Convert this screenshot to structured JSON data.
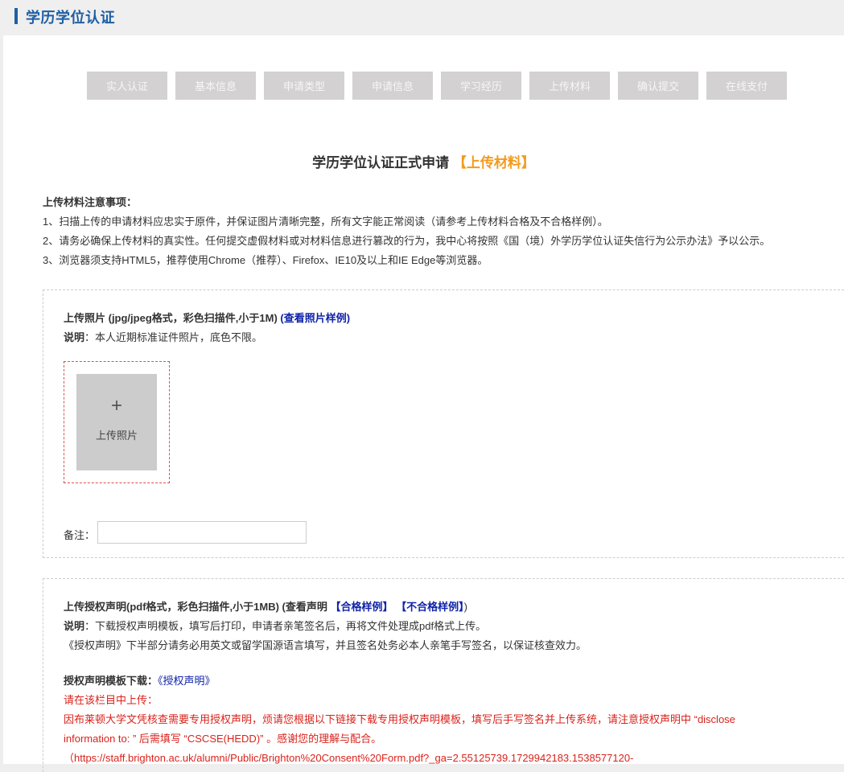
{
  "header": {
    "title": "学历学位认证"
  },
  "steps": [
    "实人认证",
    "基本信息",
    "申请类型",
    "申请信息",
    "学习经历",
    "上传材料",
    "确认提交",
    "在线支付"
  ],
  "page": {
    "heading": "学历学位认证正式申请",
    "heading_accent": "【上传材料】"
  },
  "notes": {
    "title": "上传材料注意事项：",
    "items": [
      "1、扫描上传的申请材料应忠实于原件，并保证图片清晰完整，所有文字能正常阅读（请参考上传材料合格及不合格样例）。",
      "2、请务必确保上传材料的真实性。任何提交虚假材料或对材料信息进行篡改的行为，我中心将按照《国（境）外学历学位认证失信行为公示办法》予以公示。",
      "3、浏览器须支持HTML5，推荐使用Chrome（推荐）、Firefox、IE10及以上和IE Edge等浏览器。"
    ]
  },
  "photo_section": {
    "title": "上传照片 (jpg/jpeg格式，彩色扫描件,小于1M)",
    "sample_link": "(查看照片样例)",
    "desc_label": "说明",
    "desc_text": "：本人近期标准证件照片，底色不限。",
    "upload_plus": "+",
    "upload_label": "上传照片",
    "remark_label": "备注：",
    "remark_value": ""
  },
  "auth_section": {
    "title": "上传授权声明(pdf格式，彩色扫描件,小于1MB)",
    "view_prefix": " (查看声明 ",
    "qualified_link": "【合格样例】",
    "unqualified_link": "【不合格样例】",
    "view_suffix": ")",
    "desc_label": "说明",
    "desc_text": "：下载授权声明模板，填写后打印，申请者亲笔签名后，再将文件处理成pdf格式上传。",
    "desc_line2": "《授权声明》下半部分请务必用英文或留学国源语言填写，并且签名处务必本人亲笔手写签名，以保证核查效力。",
    "template_label": "授权声明模板下载：",
    "template_link": "《授权声明》",
    "red_line1": "请在该栏目中上传：",
    "red_line2": "因布莱顿大学文凭核查需要专用授权声明，烦请您根据以下链接下载专用授权声明模板，填写后手写签名并上传系统，请注意授权声明中 “disclose",
    "red_line3": "information to: ” 后需填写 “CSCSE(HEDD)” 。感谢您的理解与配合。",
    "red_line4": "（https://staff.brighton.ac.uk/alumni/Public/Brighton%20Consent%20Form.pdf?_ga=2.55125739.1729942183.1538577120-"
  },
  "colors": {
    "brand_blue": "#1f5fa4",
    "accent_orange": "#f39a1e",
    "step_gray": "#d3d1d1",
    "warning_red": "#d9231c",
    "link_blue": "#0f22a8"
  }
}
